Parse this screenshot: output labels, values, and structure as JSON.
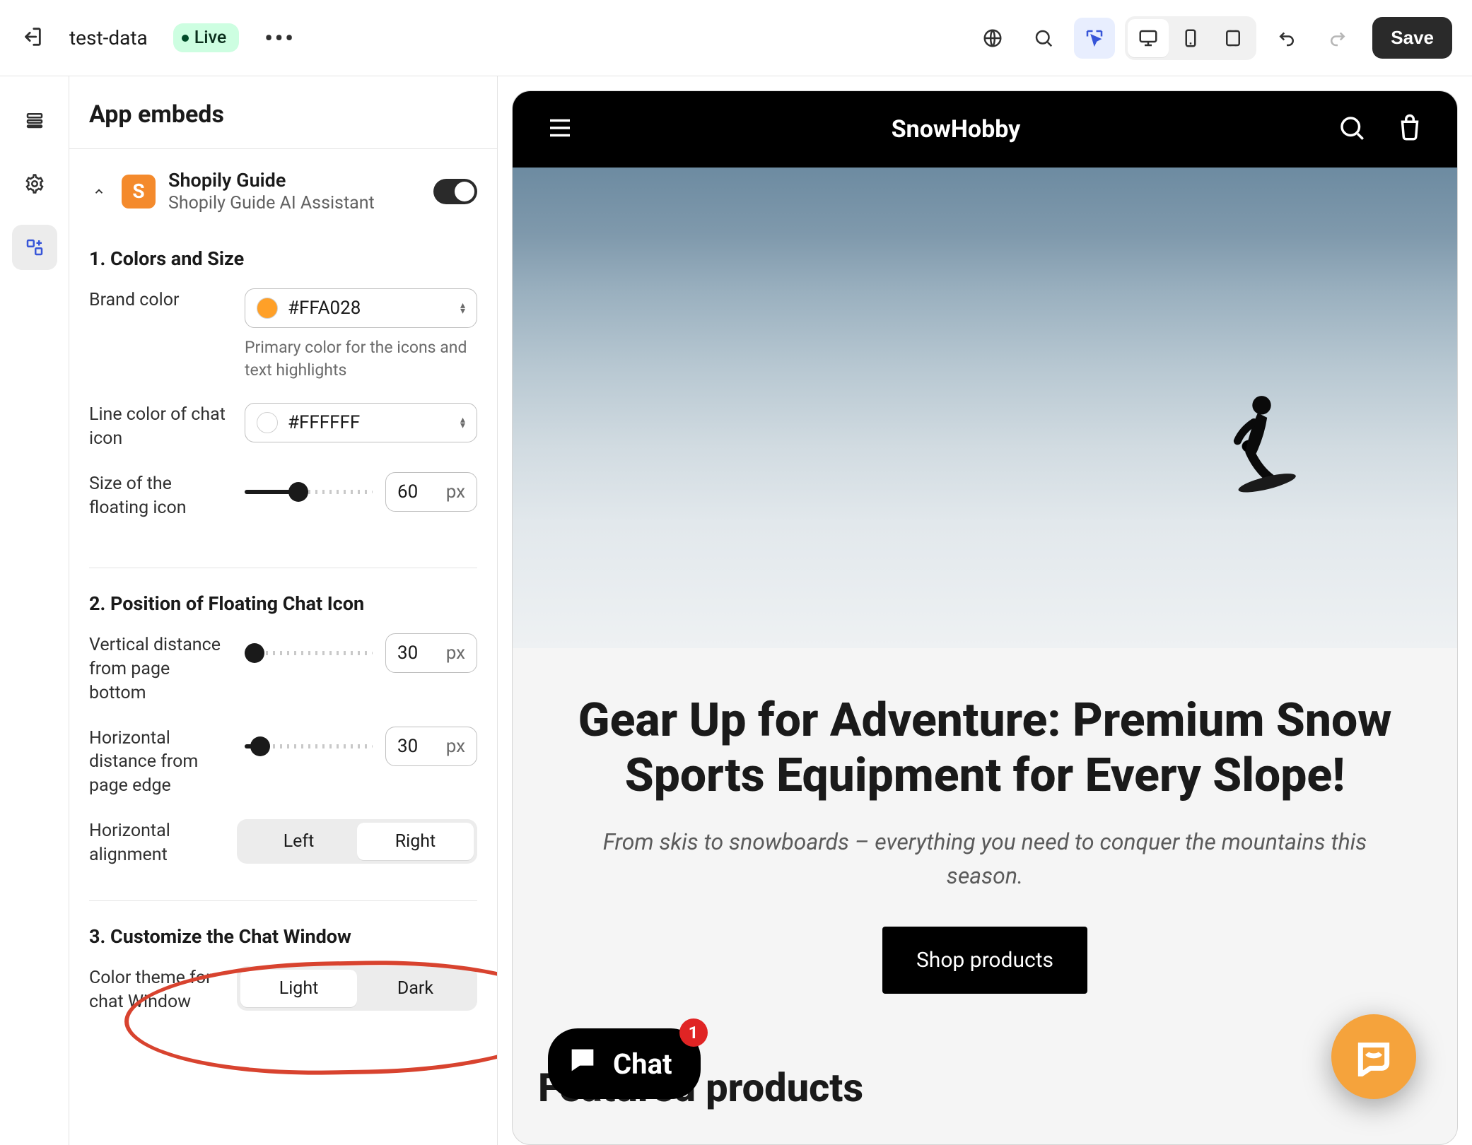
{
  "topbar": {
    "file_name": "test-data",
    "live_label": "Live",
    "save_label": "Save"
  },
  "panel": {
    "title": "App embeds",
    "app": {
      "logo_letter": "S",
      "name": "Shopily Guide",
      "subtitle": "Shopily Guide AI Assistant",
      "enabled": true
    },
    "section1": {
      "title": "1. Colors and Size",
      "brand_color": {
        "label": "Brand color",
        "value": "#FFA028",
        "help": "Primary color for the icons and text highlights"
      },
      "line_color": {
        "label": "Line color of chat icon",
        "value": "#FFFFFF"
      },
      "icon_size": {
        "label": "Size of the floating icon",
        "value": "60",
        "unit": "px",
        "fill_pct": "42%"
      }
    },
    "section2": {
      "title": "2. Position of Floating Chat Icon",
      "v_dist": {
        "label": "Vertical distance from page bottom",
        "value": "30",
        "unit": "px",
        "fill_pct": "8%"
      },
      "h_dist": {
        "label": "Horizontal distance from page edge",
        "value": "30",
        "unit": "px",
        "fill_pct": "12%"
      },
      "align": {
        "label": "Horizontal alignment",
        "left": "Left",
        "right": "Right",
        "selected": "Right"
      }
    },
    "section3": {
      "title": "3. Customize the Chat Window",
      "theme": {
        "label": "Color theme for chat Window",
        "light": "Light",
        "dark": "Dark",
        "selected": "Light"
      }
    }
  },
  "preview": {
    "brand": "SnowHobby",
    "hero_title": "Gear Up for Adventure: Premium Snow Sports Equipment for Every Slope!",
    "hero_sub": "From skis to snowboards – everything you need to conquer the mountains this season.",
    "shop_label": "Shop products",
    "featured_title": "Featured products",
    "chat_label": "Chat",
    "chat_badge": "1"
  },
  "colors": {
    "brand_swatch": "#FFA028",
    "line_swatch": "#FFFFFF",
    "float_icon_bg": "#f5a33c"
  }
}
